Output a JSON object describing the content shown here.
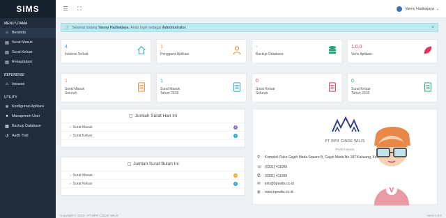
{
  "app": {
    "logo": "SIMS"
  },
  "sidebar": {
    "sections": [
      {
        "header": "MENU UTAMA",
        "items": [
          {
            "label": "Beranda",
            "icon": "home-icon"
          },
          {
            "label": "Surat Masuk",
            "icon": "document-icon"
          },
          {
            "label": "Surat Keluar",
            "icon": "document-icon"
          },
          {
            "label": "Rekapitulasi",
            "icon": "document-icon"
          }
        ]
      },
      {
        "header": "REFERENSI",
        "items": [
          {
            "label": "Instansi",
            "icon": "home-icon"
          }
        ]
      },
      {
        "header": "UTILITY",
        "items": [
          {
            "label": "Konfigurasi Aplikasi",
            "icon": "gear-icon"
          },
          {
            "label": "Manajemen User",
            "icon": "user-icon"
          },
          {
            "label": "Backup Database",
            "icon": "database-icon"
          },
          {
            "label": "Audit Trail",
            "icon": "audit-icon"
          }
        ]
      }
    ]
  },
  "topbar": {
    "user_name": "Vanny Hadiwijaya"
  },
  "alert": {
    "prefix": "Selamat datang",
    "user": "Vanny Hadiwijaya",
    "middle": ". Anda login sebagai",
    "role": "Administrator",
    "suffix": "."
  },
  "stats_row1": [
    {
      "value": "4",
      "label": "Instansi Terkait",
      "color": "#2aa6c9",
      "icon": "home-icon"
    },
    {
      "value": "1",
      "label": "Pengguna Aplikasi",
      "color": "#f28c28",
      "icon": "user-icon"
    },
    {
      "value": "-",
      "label": "Backup Database",
      "color": "#27a17b",
      "icon": "database-icon"
    },
    {
      "value": "1.0.0",
      "label": "Versi Aplikasi",
      "color": "#e3345f",
      "icon": "leaf-icon"
    }
  ],
  "stats_row2": [
    {
      "value": "1",
      "label": "Surat Masuk",
      "sub": "Seluruh",
      "color": "#f28c28",
      "icon": "document-icon"
    },
    {
      "value": "1",
      "label": "Surat Masuk",
      "sub": "Tahun 2018",
      "color": "#2aa6c9",
      "icon": "document-icon"
    },
    {
      "value": "0",
      "label": "Surat Keluar",
      "sub": "Seluruh",
      "color": "#e3345f",
      "icon": "document-icon"
    },
    {
      "value": "0",
      "label": "Surat Keluar",
      "sub": "Tahun 2018",
      "color": "#27a17b",
      "icon": "document-icon"
    }
  ],
  "panel_today": {
    "title": "Jumlah Surat Hari Ini",
    "rows": [
      {
        "label": "Surat Masuk",
        "count": "0",
        "color": "#8e6fc4"
      },
      {
        "label": "Surat Keluar",
        "count": "0",
        "color": "#2aa6c9"
      }
    ]
  },
  "panel_month": {
    "title": "Jumlah Surat Bulan Ini",
    "rows": [
      {
        "label": "Surat Masuk",
        "count": "0",
        "color": "#f0ad2b"
      },
      {
        "label": "Surat Keluar",
        "count": "0",
        "color": "#2aa6c9"
      }
    ]
  },
  "company": {
    "name": "PT BPR CINDE WILIS",
    "section_label": "Profil Instansi",
    "address": "Komplek Ruko Gajah Mada Square B, Gajah Mada No.187 Kaliuang, Kec. Jember",
    "phone": "(0331) 411999",
    "fax": "(0331) 411999",
    "email": "info@bprwilis.co.id",
    "website": "www.bprwilis.co.id"
  },
  "footer": {
    "copyright": "Copyright © 2018 - PT BPR CINDE WILIS",
    "version": "Versi 1.0.0"
  }
}
